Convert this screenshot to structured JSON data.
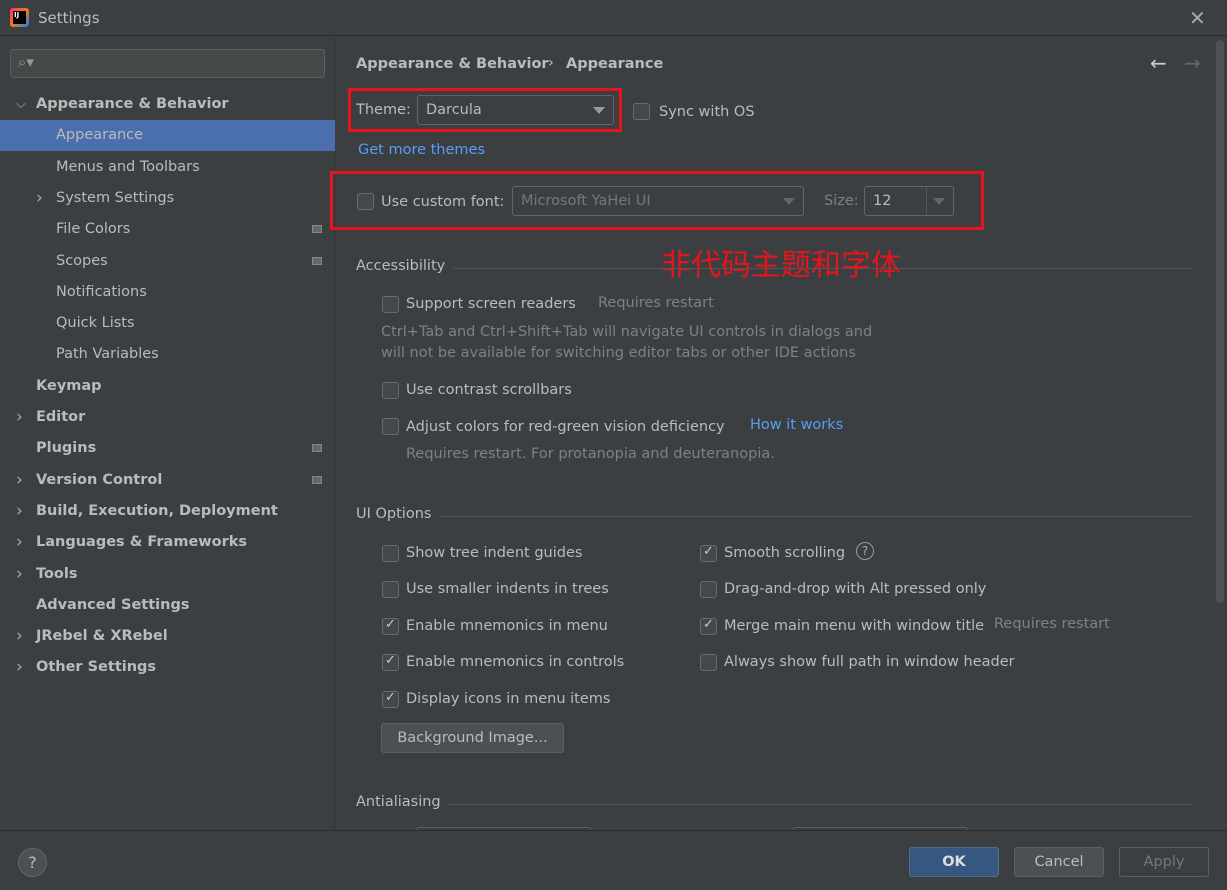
{
  "window": {
    "title": "Settings",
    "app_icon": "intellij-idea-icon"
  },
  "search": {
    "placeholder": ""
  },
  "sidebar": {
    "items": [
      {
        "label": "Appearance & Behavior",
        "expanded": true
      },
      {
        "label": "Appearance",
        "selected": true
      },
      {
        "label": "Menus and Toolbars"
      },
      {
        "label": "System Settings"
      },
      {
        "label": "File Colors"
      },
      {
        "label": "Scopes"
      },
      {
        "label": "Notifications"
      },
      {
        "label": "Quick Lists"
      },
      {
        "label": "Path Variables"
      },
      {
        "label": "Keymap"
      },
      {
        "label": "Editor"
      },
      {
        "label": "Plugins"
      },
      {
        "label": "Version Control"
      },
      {
        "label": "Build, Execution, Deployment"
      },
      {
        "label": "Languages & Frameworks"
      },
      {
        "label": "Tools"
      },
      {
        "label": "Advanced Settings"
      },
      {
        "label": "JRebel & XRebel"
      },
      {
        "label": "Other Settings"
      }
    ]
  },
  "breadcrumb": {
    "parent": "Appearance & Behavior",
    "sep": "›",
    "current": "Appearance"
  },
  "theme": {
    "label": "Theme:",
    "value": "Darcula",
    "sync_label": "Sync with OS",
    "sync_checked": false,
    "more_link": "Get more themes"
  },
  "font": {
    "label": "Use custom font:",
    "checked": false,
    "value": "Microsoft YaHei UI",
    "size_label": "Size:",
    "size_value": "12"
  },
  "annotation": "非代码主题和字体",
  "accessibility": {
    "title": "Accessibility",
    "screen_readers": "Support screen readers",
    "screen_readers_note": "Requires restart",
    "desc1": "Ctrl+Tab and Ctrl+Shift+Tab will navigate UI controls in dialogs and",
    "desc2": "will not be available for switching editor tabs or other IDE actions",
    "contrast": "Use contrast scrollbars",
    "color_adjust": "Adjust colors for red-green vision deficiency",
    "how_link": "How it works",
    "color_note": "Requires restart. For protanopia and deuteranopia."
  },
  "ui_options": {
    "title": "UI Options",
    "left": [
      {
        "label": "Show tree indent guides",
        "checked": false
      },
      {
        "label": "Use smaller indents in trees",
        "checked": false
      },
      {
        "label": "Enable mnemonics in menu",
        "checked": true
      },
      {
        "label": "Enable mnemonics in controls",
        "checked": true
      },
      {
        "label": "Display icons in menu items",
        "checked": true
      }
    ],
    "right": [
      {
        "label": "Smooth scrolling",
        "checked": true
      },
      {
        "label": "Drag-and-drop with Alt pressed only",
        "checked": false
      },
      {
        "label": "Merge main menu with window title",
        "checked": true
      },
      {
        "label": "Always show full path in window header",
        "checked": false
      }
    ],
    "merge_note": "Requires restart",
    "bg_button": "Background Image..."
  },
  "antialiasing": {
    "title": "Antialiasing"
  },
  "footer": {
    "ok": "OK",
    "cancel": "Cancel",
    "apply": "Apply",
    "help": "?"
  },
  "colors": {
    "selection": "#4b6eaf",
    "link": "#589df6",
    "annotation": "#e8141c",
    "ok": "#365880"
  }
}
